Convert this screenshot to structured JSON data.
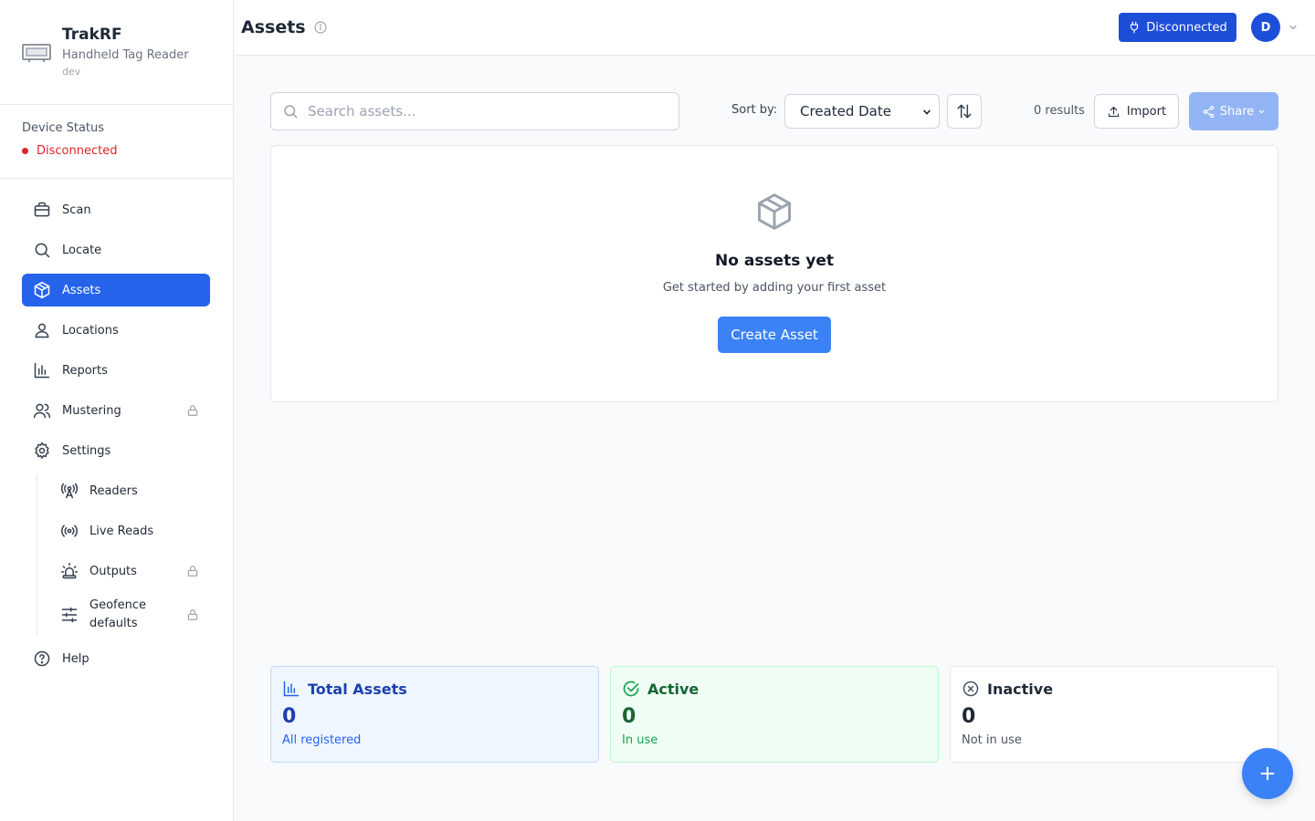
{
  "brand": {
    "title": "TrakRF",
    "subtitle": "Handheld Tag Reader",
    "env": "dev",
    "logo_icon": "rfid-reader-icon"
  },
  "device": {
    "label": "Device Status",
    "status": "Disconnected",
    "status_color": "#dc2626"
  },
  "nav": {
    "items": [
      {
        "label": "Scan",
        "icon": "box-icon"
      },
      {
        "label": "Locate",
        "icon": "search-icon"
      },
      {
        "label": "Assets",
        "icon": "package-icon",
        "active": true
      },
      {
        "label": "Locations",
        "icon": "map-pin-icon"
      },
      {
        "label": "Reports",
        "icon": "bar-chart-icon"
      },
      {
        "label": "Mustering",
        "icon": "users-icon",
        "locked": true
      },
      {
        "label": "Settings",
        "icon": "gear-icon"
      }
    ],
    "settings_children": [
      {
        "label": "Readers",
        "icon": "antenna-icon"
      },
      {
        "label": "Live Reads",
        "icon": "radio-icon"
      },
      {
        "label": "Outputs",
        "icon": "siren-icon",
        "locked": true
      },
      {
        "label": "Geofence defaults",
        "icon": "sliders-icon",
        "locked": true
      }
    ],
    "help": {
      "label": "Help",
      "icon": "help-circle-icon"
    }
  },
  "header": {
    "title": "Assets",
    "connection_label": "Disconnected",
    "avatar_initial": "D",
    "accent": "#1d4ed8"
  },
  "toolbar": {
    "search_placeholder": "Search assets...",
    "sort_label": "Sort by:",
    "sort_value": "Created Date",
    "results": "0 results",
    "import_label": "Import",
    "share_label": "Share"
  },
  "empty_state": {
    "title": "No assets yet",
    "subtitle": "Get started by adding your first asset",
    "button": "Create Asset"
  },
  "stats": {
    "total": {
      "title": "Total Assets",
      "value": "0",
      "sub": "All registered"
    },
    "active": {
      "title": "Active",
      "value": "0",
      "sub": "In use"
    },
    "inactive": {
      "title": "Inactive",
      "value": "0",
      "sub": "Not in use"
    }
  }
}
